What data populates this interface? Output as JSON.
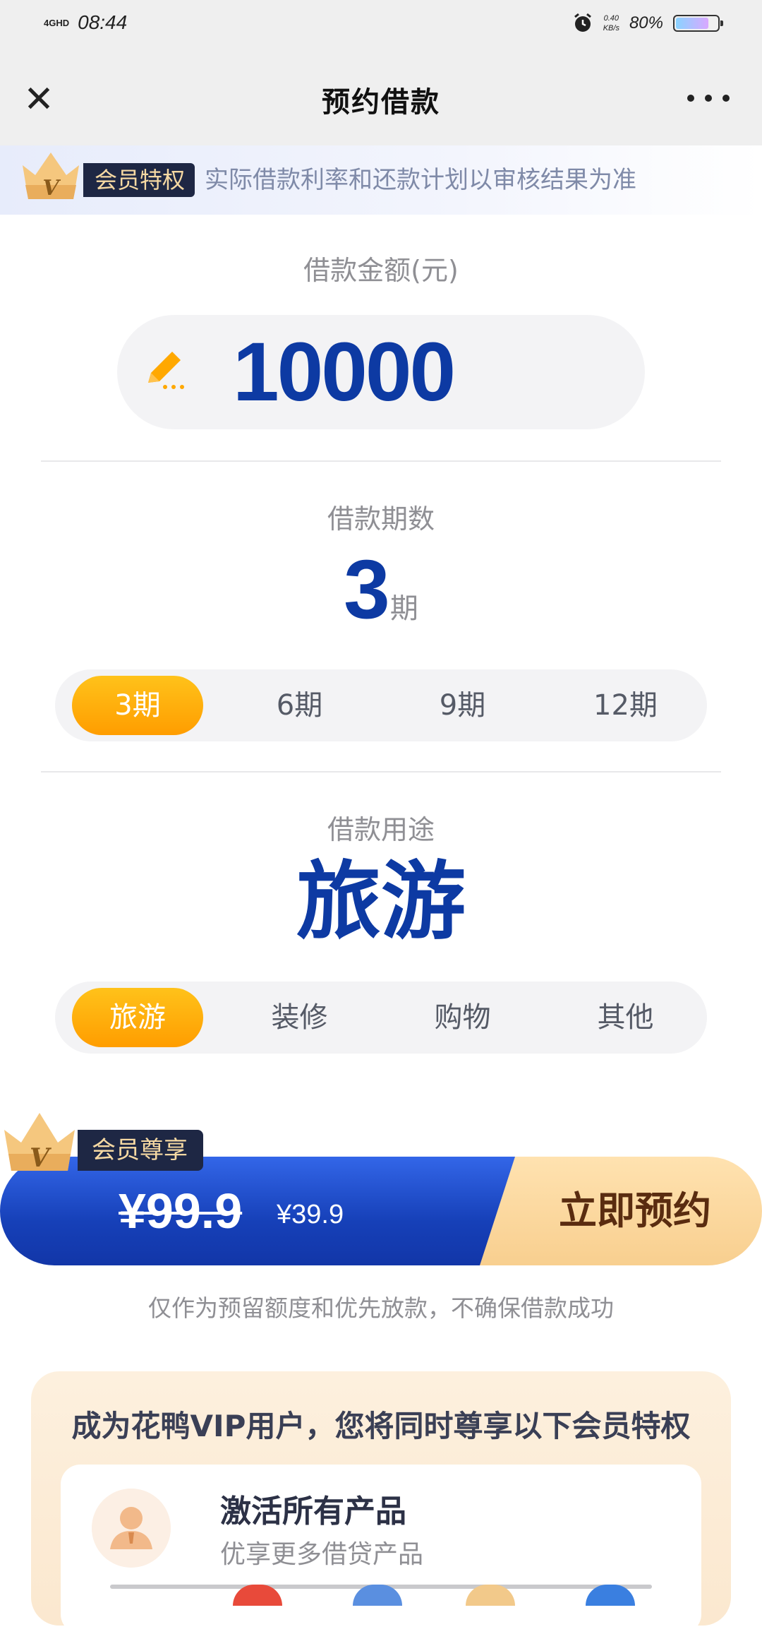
{
  "status_bar": {
    "network": "4GHD",
    "time": "08:44",
    "speed_value": "0.40",
    "speed_unit": "KB/s",
    "battery": "80%",
    "battery_level": 0.8
  },
  "nav": {
    "title": "预约借款"
  },
  "banner": {
    "tag": "会员特权",
    "text": "实际借款利率和还款计划以审核结果为准"
  },
  "amount": {
    "label": "借款金额(元)",
    "value": "10000"
  },
  "term": {
    "label": "借款期数",
    "value": "3",
    "unit": "期",
    "options": [
      "3期",
      "6期",
      "9期",
      "12期"
    ],
    "selected_index": 0
  },
  "purpose": {
    "label": "借款用途",
    "value": "旅游",
    "options": [
      "旅游",
      "装修",
      "购物",
      "其他"
    ],
    "selected_index": 0
  },
  "cta": {
    "tag": "会员尊享",
    "original_price": "¥99.9",
    "price": "¥39.9",
    "button": "立即预约"
  },
  "note": "仅作为预留额度和优先放款，不确保借款成功",
  "benefits": {
    "title": "成为花鸭VIP用户，您将同时尊享以下会员特权",
    "items": [
      {
        "title": "激活所有产品",
        "subtitle": "优享更多借贷产品"
      }
    ]
  },
  "colors": {
    "primary": "#0d3aa3",
    "accent": "#ffa800",
    "gold": "#f8cf8f"
  }
}
